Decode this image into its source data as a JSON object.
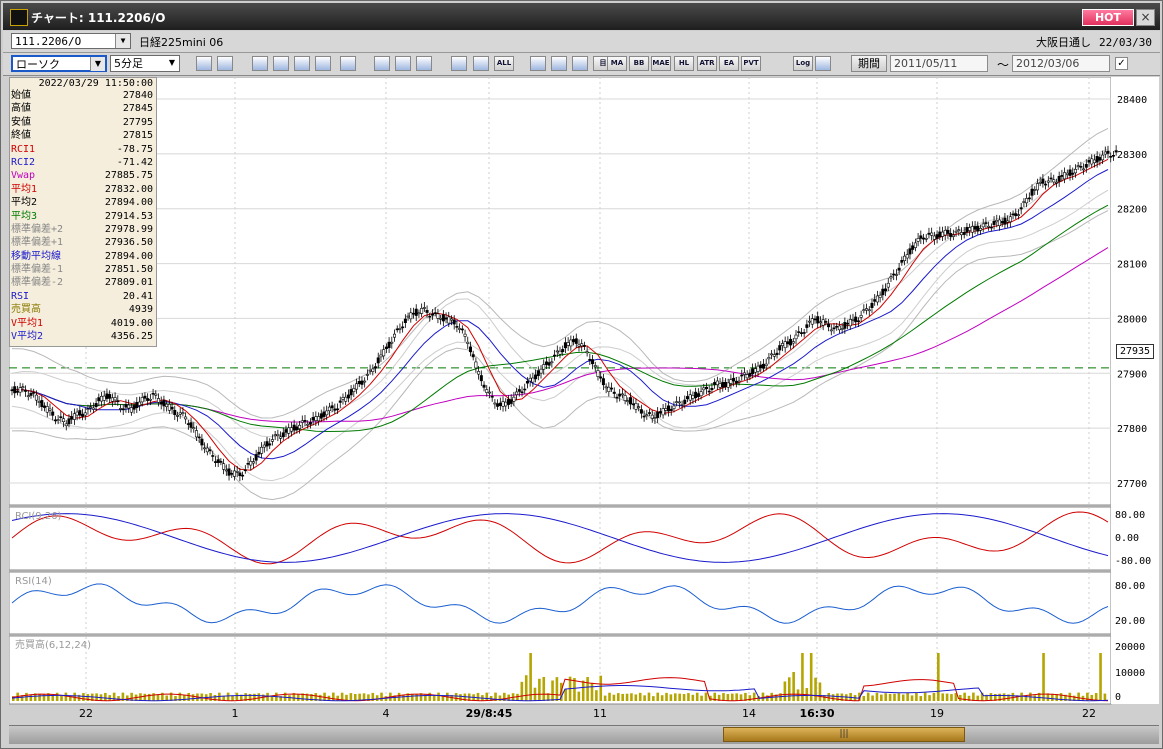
{
  "window": {
    "title": "チャート: 111.2206/O",
    "hot_label": "HOT",
    "close_label": "×"
  },
  "symbol_bar": {
    "code": "111.2206/O",
    "name": "日経225mini 06",
    "exchange": "大阪日通し",
    "date": "22/03/30"
  },
  "toolbar": {
    "chart_type": "ローソク",
    "interval": "5分足",
    "buttons": [
      "search",
      "crosshair",
      "compare",
      "zoom",
      "grid",
      "candles",
      "info",
      "drawing",
      "arrow",
      "undo",
      "box1",
      "box2",
      "all",
      "bold",
      "wrench",
      "color",
      "mark",
      "ma",
      "bb",
      "mae",
      "hl",
      "atr",
      "ea",
      "pvt",
      "log",
      "export"
    ],
    "button_labels": {
      "all": "ALL",
      "mark": "目",
      "ma": "MA",
      "bb": "BB",
      "mae": "MAE",
      "hl": "HL",
      "atr": "ATR",
      "ea": "EA",
      "pvt": "PVT",
      "log": "Log"
    },
    "period_label": "期間",
    "from_date": "2011/05/11",
    "tilde": "～",
    "to_date": "2012/03/06",
    "checkbox_mark": "✓"
  },
  "info_panel": {
    "timestamp": "2022/03/29  11:50:00",
    "rows": [
      {
        "label": "始値",
        "value": "27840",
        "color": "#000000"
      },
      {
        "label": "高値",
        "value": "27845",
        "color": "#000000"
      },
      {
        "label": "安値",
        "value": "27795",
        "color": "#000000"
      },
      {
        "label": "終値",
        "value": "27815",
        "color": "#000000"
      },
      {
        "label": "RCI1",
        "value": "-78.75",
        "color": "#d00000"
      },
      {
        "label": "RCI2",
        "value": "-71.42",
        "color": "#1a1acc"
      },
      {
        "label": "Vwap",
        "value": "27885.75",
        "color": "#c000c0"
      },
      {
        "label": "平均1",
        "value": "27832.00",
        "color": "#d00000"
      },
      {
        "label": "平均2",
        "value": "27894.00",
        "color": "#000000"
      },
      {
        "label": "平均3",
        "value": "27914.53",
        "color": "#007a00"
      },
      {
        "label": "標準偏差+2",
        "value": "27978.99",
        "color": "#888888"
      },
      {
        "label": "標準偏差+1",
        "value": "27936.50",
        "color": "#888888"
      },
      {
        "label": "移動平均線",
        "value": "27894.00",
        "color": "#1a1acc"
      },
      {
        "label": "標準偏差-1",
        "value": "27851.50",
        "color": "#888888"
      },
      {
        "label": "標準偏差-2",
        "value": "27809.01",
        "color": "#888888"
      },
      {
        "label": "RSI",
        "value": "20.41",
        "color": "#1a1acc"
      },
      {
        "label": "売買高",
        "value": "4939",
        "color": "#8a7a00"
      },
      {
        "label": "V平均1",
        "value": "4019.00",
        "color": "#d00000"
      },
      {
        "label": "V平均2",
        "value": "4356.25",
        "color": "#1a1acc"
      }
    ]
  },
  "chart_data": {
    "type": "candlestick",
    "price_axis": {
      "ticks": [
        28400,
        28300,
        28200,
        28100,
        28000,
        27900,
        27800,
        27700
      ],
      "range": [
        27660,
        28440
      ]
    },
    "current_price_label": "27935",
    "dashed_level": 27910,
    "x_tick_labels": [
      "22",
      "1",
      "4",
      "29/8:45",
      "11",
      "14",
      "16:30",
      "19",
      "22"
    ],
    "price_path": [
      27870,
      27870,
      27860,
      27840,
      27820,
      27810,
      27825,
      27830,
      27850,
      27860,
      27840,
      27835,
      27850,
      27860,
      27845,
      27830,
      27820,
      27790,
      27760,
      27740,
      27720,
      27715,
      27735,
      27760,
      27780,
      27790,
      27800,
      27810,
      27815,
      27830,
      27840,
      27860,
      27880,
      27900,
      27930,
      27960,
      27990,
      28010,
      28015,
      28005,
      28000,
      27990,
      27960,
      27900,
      27860,
      27840,
      27850,
      27870,
      27890,
      27910,
      27930,
      27950,
      27960,
      27940,
      27900,
      27870,
      27860,
      27850,
      27830,
      27820,
      27830,
      27840,
      27850,
      27860,
      27870,
      27880,
      27880,
      27890,
      27900,
      27910,
      27930,
      27950,
      27960,
      27980,
      28000,
      27990,
      27980,
      27990,
      28000,
      28020,
      28040,
      28070,
      28100,
      28130,
      28150,
      28150,
      28155,
      28155,
      28160,
      28165,
      28170,
      28175,
      28180,
      28200,
      28230,
      28250,
      28250,
      28260,
      28270,
      28280,
      28290,
      28300
    ],
    "panels": [
      {
        "label": "RCI(9,26)",
        "ticks": [
          "80.00",
          "0.00",
          "-80.00"
        ]
      },
      {
        "label": "RSI(14)",
        "ticks": [
          "80.00",
          "20.00"
        ]
      },
      {
        "label": "売買高(6,12,24)",
        "ticks": [
          "20000",
          "10000",
          "0"
        ]
      }
    ]
  },
  "colors": {
    "bg": "#ffffff",
    "candle": "#000000",
    "ma_short": "#d00000",
    "ma_mid": "#1a1acc",
    "ma_long": "#007a00",
    "vwap": "#c000c0",
    "band": "#a0a0a0",
    "volume": "#b5a500",
    "dashed": "#007a00"
  },
  "scrollbar": {
    "grip": "|||"
  }
}
